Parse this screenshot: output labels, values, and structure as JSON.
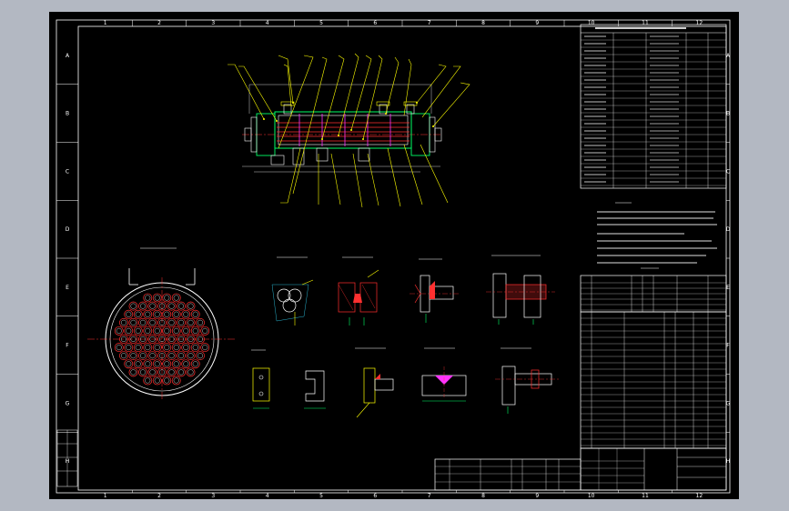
{
  "canvas": {
    "background": "#000000",
    "frame_color": "#ffffff",
    "outside_color": "#b3b8c2"
  },
  "colors": {
    "yellow": "#ffff00",
    "red": "#ff3030",
    "green": "#00ff66",
    "magenta": "#ff33ff",
    "cyan": "#33ddff"
  },
  "zones": {
    "columns": [
      "1",
      "2",
      "3",
      "4",
      "5",
      "6",
      "7",
      "8",
      "9",
      "10",
      "11",
      "12"
    ],
    "rows": [
      "A",
      "B",
      "C",
      "D",
      "E",
      "F",
      "G",
      "H"
    ]
  },
  "drawing": {
    "views": {
      "main": "main-elevation-view",
      "tube_sheet": "tube-sheet-section-view",
      "details": [
        "detail-1",
        "detail-2",
        "detail-3",
        "detail-4",
        "detail-5",
        "detail-6",
        "detail-7",
        "detail-8"
      ]
    },
    "tables": [
      "design-data-table",
      "technical-requirements",
      "nozzle-table",
      "parts-list",
      "title-block"
    ]
  }
}
